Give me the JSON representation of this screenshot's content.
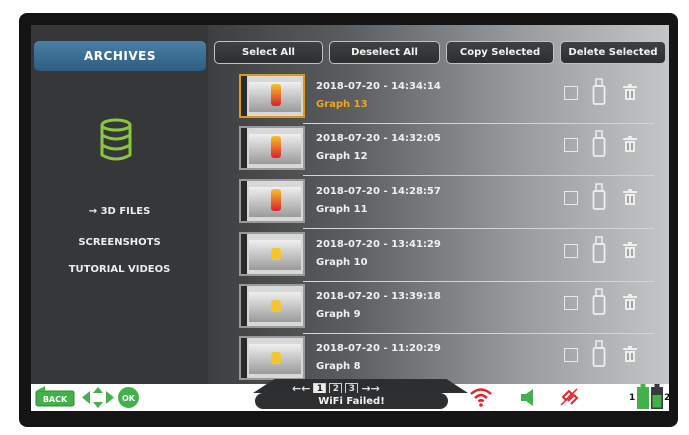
{
  "sidebar": {
    "tab_label": "ARCHIVES",
    "items": [
      {
        "label": "→ 3D FILES"
      },
      {
        "label": "SCREENSHOTS"
      },
      {
        "label": "TUTORIAL VIDEOS"
      }
    ],
    "db_icon": "database-icon"
  },
  "toolbar": {
    "select_all": "Select All",
    "deselect_all": "Deselect All",
    "copy_selected": "Copy Selected",
    "delete_selected": "Delete Selected"
  },
  "files": [
    {
      "date": "2018-07-20 - 14:34:14",
      "name": "Graph 13",
      "selected": true,
      "thumb": "red"
    },
    {
      "date": "2018-07-20 - 14:32:05",
      "name": "Graph 12",
      "selected": false,
      "thumb": "red"
    },
    {
      "date": "2018-07-20 - 14:28:57",
      "name": "Graph 11",
      "selected": false,
      "thumb": "red"
    },
    {
      "date": "2018-07-20 - 13:41:29",
      "name": "Graph 10",
      "selected": false,
      "thumb": "yellow"
    },
    {
      "date": "2018-07-20 - 13:39:18",
      "name": "Graph 9",
      "selected": false,
      "thumb": "yellow"
    },
    {
      "date": "2018-07-20 - 11:20:29",
      "name": "Graph 8",
      "selected": false,
      "thumb": "yellow"
    }
  ],
  "pager": {
    "prev": "←←",
    "next": "→→",
    "pages": [
      "1",
      "2",
      "3"
    ],
    "current": "1"
  },
  "status": {
    "message": "WiFi Failed!"
  },
  "bottom": {
    "back_label": "BACK",
    "ok_label": "OK",
    "battery1": "1",
    "battery2": "2"
  },
  "colors": {
    "accent": "#2e6a92",
    "highlight": "#f1a619",
    "green": "#43b14a",
    "wifi_error": "#e3232b"
  }
}
